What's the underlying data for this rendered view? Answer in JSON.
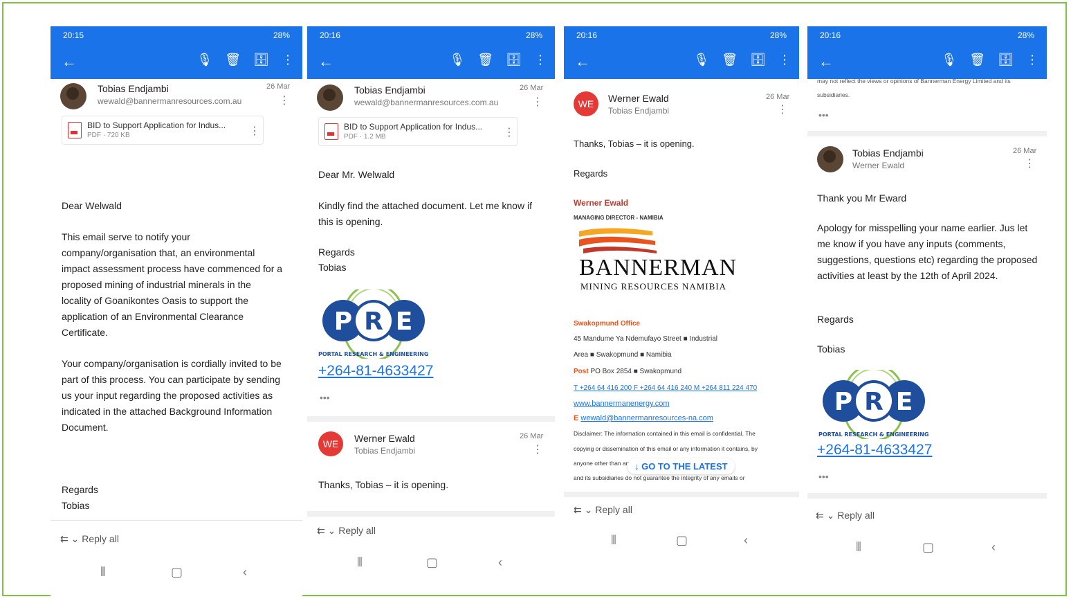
{
  "statusbar": {
    "time1": "20:15",
    "time2": "20:16",
    "battery": "28%"
  },
  "phone1": {
    "sender": "Tobias Endjambi",
    "address": "wewald@bannermanresources.com.au",
    "date": "26 Mar",
    "attachment": {
      "name": "BID to Support Application for Indus...",
      "meta": "PDF · 720 KB"
    },
    "greeting": "Dear Welwald",
    "para1": "This email serve to notify your company/organisation that, an environmental impact assessment process have commenced for a proposed mining of industrial minerals in the locality of Goanikontes Oasis to support the application of an Environmental Clearance Certificate.",
    "para2": "Your company/organisation is cordially invited to be part of this process. You can participate by sending us your input regarding the proposed activities as indicated in the attached Background Information Document.",
    "regards": "Regards",
    "name": "Tobias",
    "reply": "Reply all"
  },
  "phone2": {
    "sender": "Tobias Endjambi",
    "address": "wewald@bannermanresources.com.au",
    "date": "26 Mar",
    "attachment": {
      "name": "BID to Support Application for Indus...",
      "meta": "PDF · 1.2 MB"
    },
    "greeting": "Dear Mr. Welwald",
    "para1": "Kindly find the attached document. Let me know if this is opening.",
    "regards": "Regards",
    "name": "Tobias",
    "logo_tagline": "PORTAL RESEARCH & ENGINEERING",
    "phone": "+264-81-4633427",
    "reply_sender": "Werner Ewald",
    "reply_to": "Tobias Endjambi",
    "reply_date": "26 Mar",
    "reply_initials": "WE",
    "reply_body": "Thanks, Tobias – it is opening.",
    "reply": "Reply all"
  },
  "phone3": {
    "sender": "Werner Ewald",
    "to": "Tobias Endjambi",
    "date": "26 Mar",
    "initials": "WE",
    "body": "Thanks, Tobias – it is opening.",
    "regards": "Regards",
    "sig_name": "Werner Ewald",
    "sig_title": "MANAGING DIRECTOR - NAMIBIA",
    "company": "BANNERMAN",
    "company_sub": "MINING RESOURCES NAMIBIA",
    "office": "Swakopmund Office",
    "addr1": "45 Mandume Ya Ndemufayo Street ■ Industrial",
    "addr2": "Area ■ Swakopmund ■ Namibia",
    "post": "PO Box 2854 ■ Swakopmund",
    "contacts": "T +264 64 416 200 F +264 64 416 240 M +264 811 224 470",
    "web": "www.bannermanenergy.com",
    "email": "wewald@bannermanresources-na.com",
    "disclaimer1": "Disclaimer: The information contained in this email is confidential. The",
    "disclaimer2": "copying or dissemination of this email or any information it contains, by",
    "disclaimer3": "anyone other than                                       an Energy Limited",
    "disclaimer4": "and its subsidiaries do not guarantee the integrity of any emails or",
    "goto": "↓ GO TO THE LATEST",
    "reply": "Reply all"
  },
  "phone4": {
    "top_text": "may not reflect the views or opinions of Bannerman Energy Limited and its",
    "top_text2": "subsidiaries.",
    "sender": "Tobias Endjambi",
    "to": "Werner Ewald",
    "date": "26 Mar",
    "greeting": "Thank you Mr Eward",
    "para1": "Apology for misspelling your name earlier. Jus let me know  if you have any inputs (comments, suggestions, questions etc) regarding the proposed activities at least by the 12th of April 2024.",
    "regards": "Regards",
    "name": "Tobias",
    "logo_tagline": "PORTAL RESEARCH & ENGINEERING",
    "phone": "+264-81-4633427",
    "reply": "Reply all"
  },
  "logo_text": {
    "p": "P",
    "r": "R",
    "e": "E"
  },
  "colors": {
    "appbar": "#1a73e8",
    "border": "#7fc241",
    "link": "#1a73e8"
  }
}
